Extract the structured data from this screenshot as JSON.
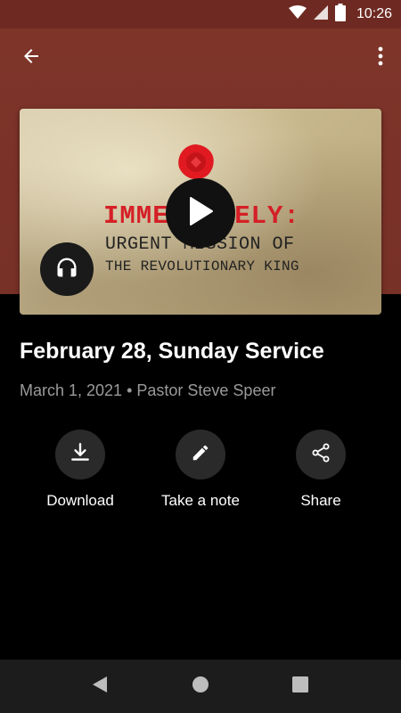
{
  "status_bar": {
    "time": "10:26",
    "icons": [
      "wifi-icon",
      "signal-icon",
      "battery-icon"
    ],
    "background": "#6e2a22"
  },
  "app_bar": {
    "back_icon": "arrow-back-icon",
    "menu_icon": "more-vert-icon"
  },
  "artwork": {
    "line1": "IMMEDIATELY:",
    "line2": "URGENT MISSION OF",
    "line3": "THE REVOLUTIONARY KING",
    "accent": "#d51f26",
    "play_icon": "play-icon",
    "audio_icon": "headphones-icon"
  },
  "sermon": {
    "title": "February 28, Sunday Service",
    "meta": "March 1, 2021 • Pastor Steve Speer"
  },
  "actions": [
    {
      "label": "Download",
      "icon": "download-icon"
    },
    {
      "label": "Take a note",
      "icon": "pencil-icon"
    },
    {
      "label": "Share",
      "icon": "share-icon"
    }
  ],
  "nav_bar": {
    "icons": [
      "nav-back-icon",
      "nav-home-icon",
      "nav-recents-icon"
    ]
  },
  "colors": {
    "header": "#7e3429",
    "background": "#000000",
    "meta_text": "#9a9a9a",
    "action_circle": "#2a2a2a"
  }
}
